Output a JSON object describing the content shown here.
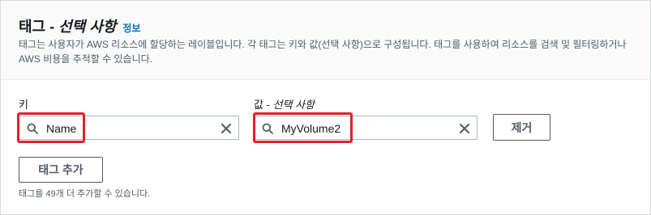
{
  "section": {
    "title": "태그",
    "title_dash": " - ",
    "title_optional": "선택 사항",
    "info_link": "정보",
    "description": "태그는 사용자가 AWS 리소스에 할당하는 레이블입니다. 각 태그는 키와 값(선택 사항)으로 구성됩니다. 태그를 사용하여 리소스를 검색 및 필터링하거나 AWS 비용을 추적할 수 있습니다."
  },
  "tag_row": {
    "key_label": "키",
    "value_label_main": "값",
    "value_label_dash": " - ",
    "value_label_optional": "선택 사항",
    "key_value": "Name",
    "value_value": "MyVolume2",
    "remove_button": "제거"
  },
  "add_tag_button": "태그 추가",
  "hint": "태그를 49개 더 추가할 수 있습니다.",
  "icons": {
    "search": "search-icon",
    "clear": "close-icon"
  },
  "colors": {
    "highlight": "#e0202e",
    "link": "#0073bb"
  }
}
